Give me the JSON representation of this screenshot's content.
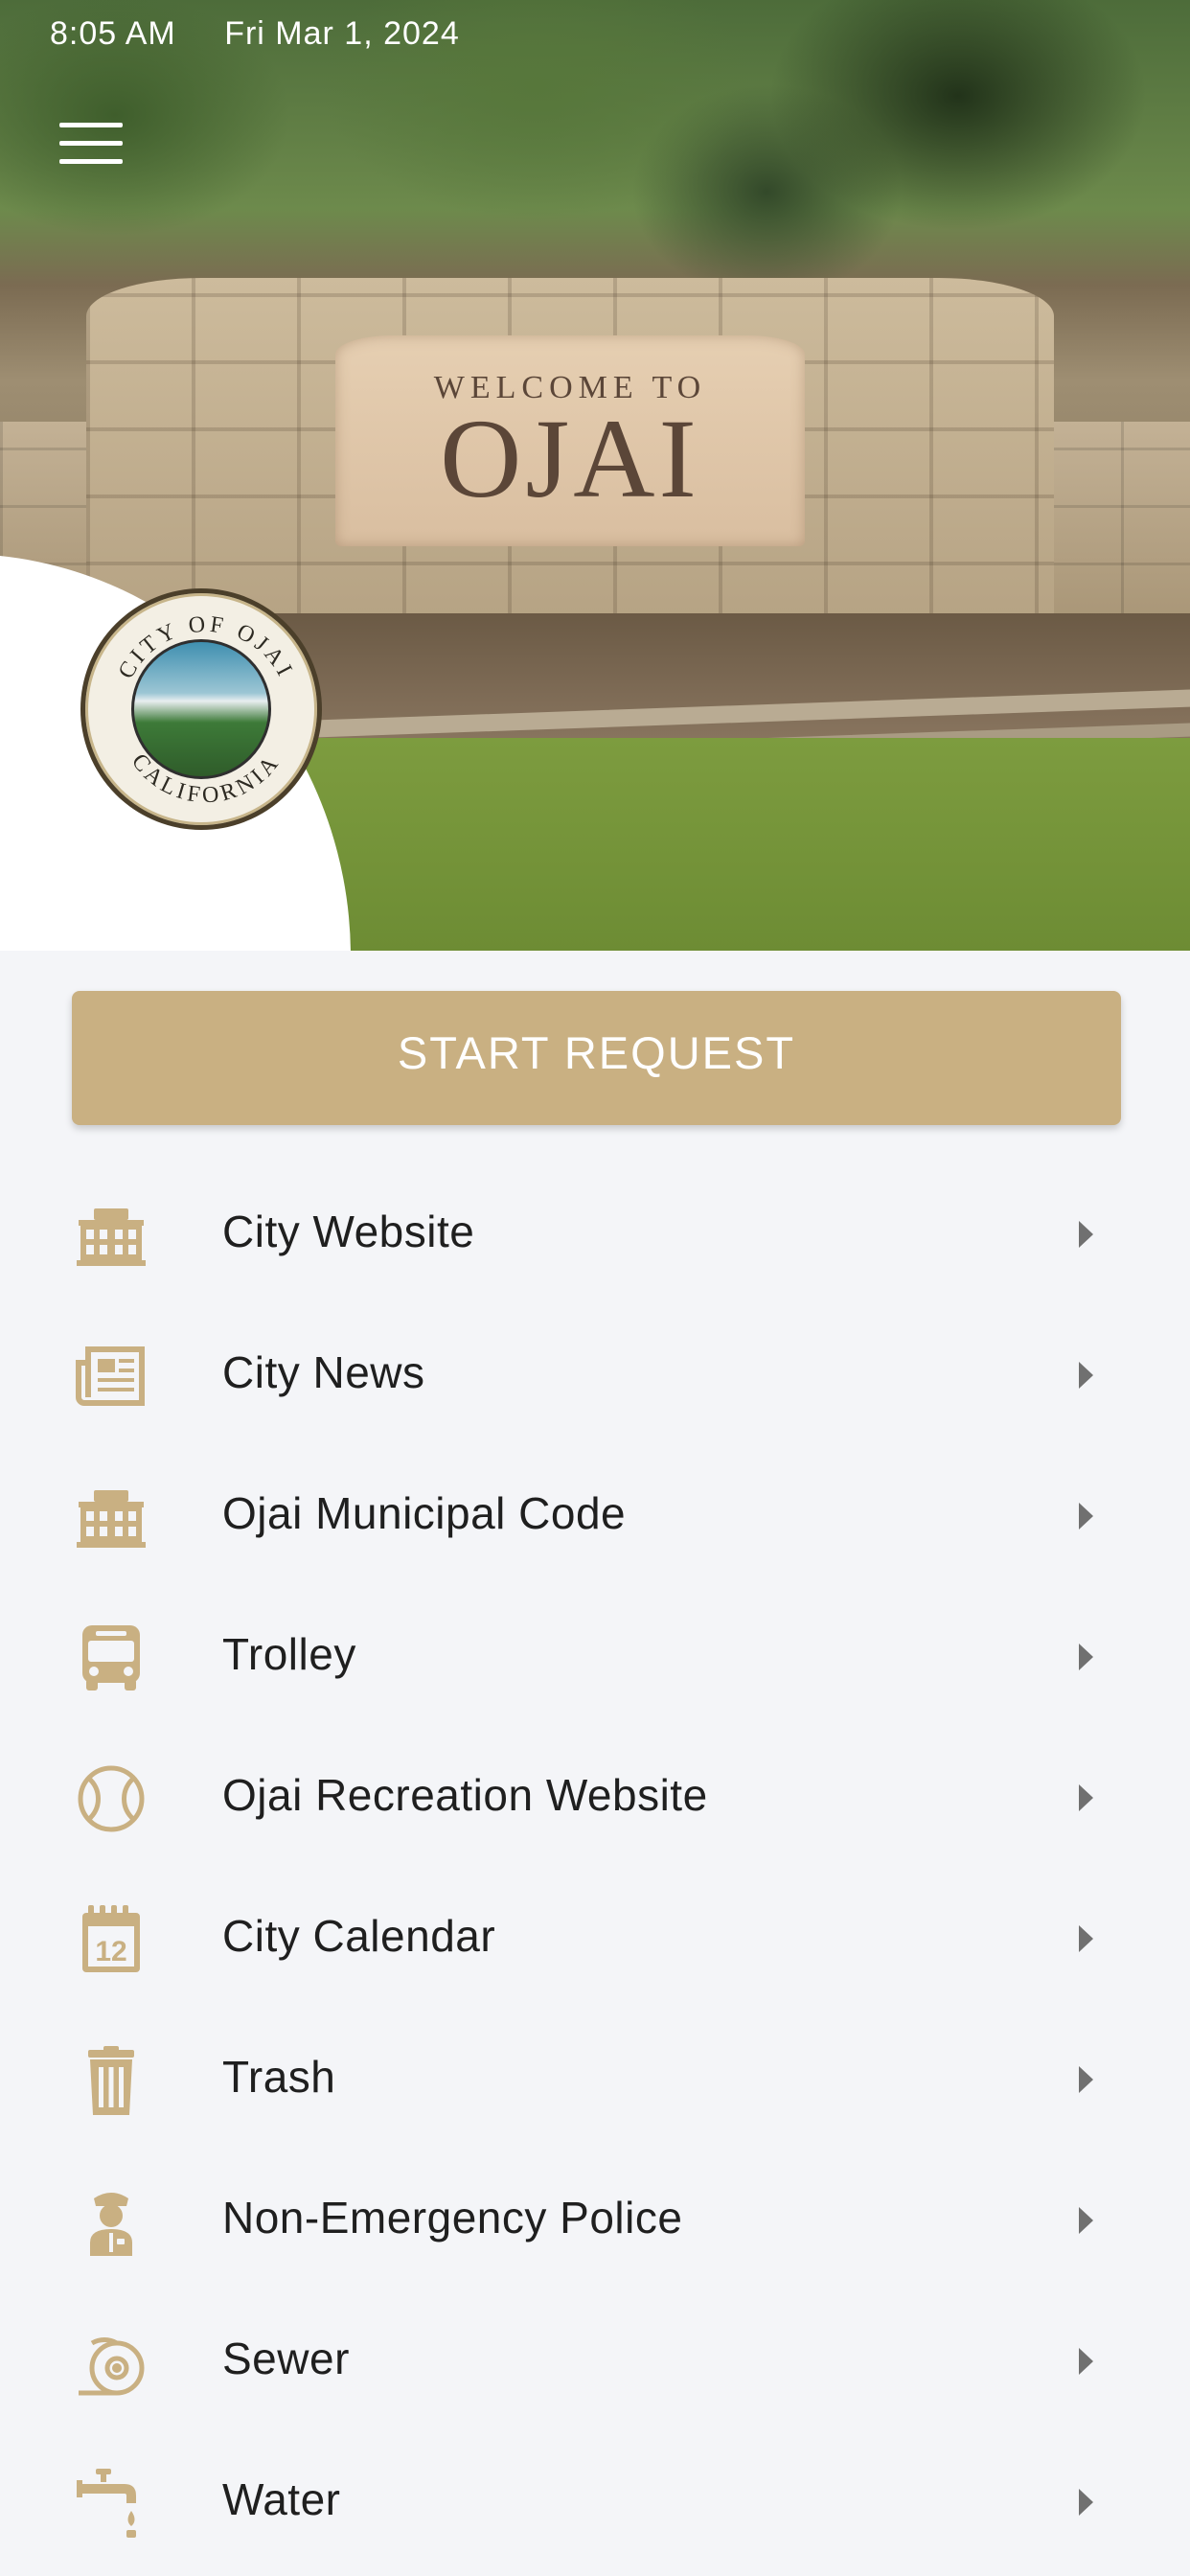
{
  "status_bar": {
    "time": "8:05 AM",
    "date": "Fri Mar 1, 2024"
  },
  "hero": {
    "sign_small": "WELCOME TO",
    "sign_big": "OJAI",
    "seal_text_top": "CITY OF OJAI",
    "seal_text_bottom": "CALIFORNIA"
  },
  "start_button": {
    "label": "START REQUEST"
  },
  "menu": {
    "items": [
      {
        "label": "City Website",
        "icon": "building-icon"
      },
      {
        "label": "City News",
        "icon": "newspaper-icon"
      },
      {
        "label": "Ojai Municipal Code",
        "icon": "building-icon"
      },
      {
        "label": "Trolley",
        "icon": "bus-icon"
      },
      {
        "label": "Ojai Recreation Website",
        "icon": "baseball-icon"
      },
      {
        "label": "City Calendar",
        "icon": "calendar-icon"
      },
      {
        "label": "Trash",
        "icon": "trash-can-icon"
      },
      {
        "label": "Non-Emergency Police",
        "icon": "police-officer-icon"
      },
      {
        "label": "Sewer",
        "icon": "sewer-pipe-icon"
      },
      {
        "label": "Water",
        "icon": "water-faucet-icon"
      }
    ]
  },
  "colors": {
    "accent": "#c9b082",
    "background": "#f4f5f8",
    "text": "#1f1f1f",
    "chevron": "#707070"
  }
}
